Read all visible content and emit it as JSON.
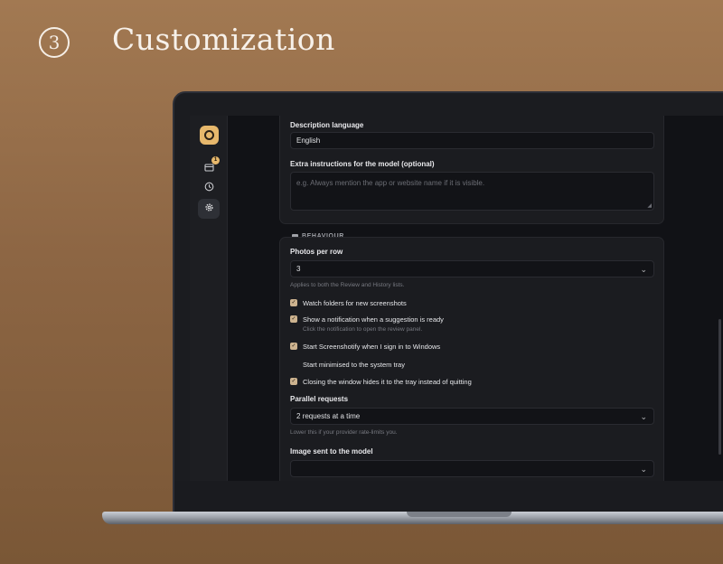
{
  "hero": {
    "step": "3",
    "title": "Customization"
  },
  "rail": {
    "badge_count": "1"
  },
  "language": {
    "label": "Description language",
    "value": "English"
  },
  "extra": {
    "label": "Extra instructions for the model (optional)",
    "placeholder": "e.g. Always mention the app or website name if it is visible."
  },
  "behaviour": {
    "title": "BEHAVIOUR",
    "photos_label": "Photos per row",
    "photos_value": "3",
    "photos_hint": "Applies to both the Review and History lists.",
    "options": [
      {
        "label": "Watch folders for new screenshots",
        "checked": true,
        "sub": ""
      },
      {
        "label": "Show a notification when a suggestion is ready",
        "checked": true,
        "sub": "Click the notification to open the review panel."
      },
      {
        "label": "Start Screenshotify when I sign in to Windows",
        "checked": true,
        "sub": ""
      },
      {
        "label": "Start minimised to the system tray",
        "checked": false,
        "sub": ""
      },
      {
        "label": "Closing the window hides it to the tray instead of quitting",
        "checked": true,
        "sub": ""
      }
    ],
    "parallel_label": "Parallel requests",
    "parallel_value": "2 requests at a time",
    "parallel_hint": "Lower this if your provider rate-limits you.",
    "image_label": "Image sent to the model",
    "image_value": ""
  },
  "colors": {
    "accent": "#e7b86c",
    "checkbox": "#cdb38f",
    "background": "#8d6644"
  }
}
